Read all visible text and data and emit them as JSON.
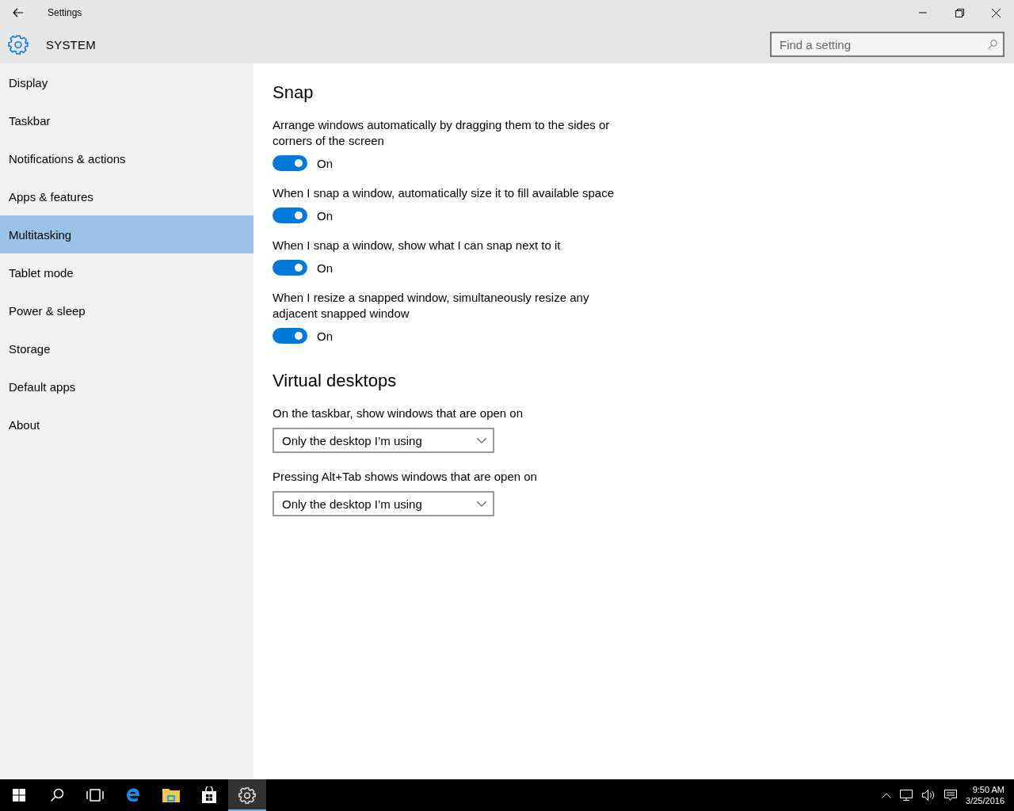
{
  "window": {
    "title": "Settings"
  },
  "header": {
    "title": "SYSTEM",
    "search": {
      "placeholder": "Find a setting"
    }
  },
  "sidebar": {
    "items": [
      {
        "label": "Display",
        "selected": false
      },
      {
        "label": "Taskbar",
        "selected": false
      },
      {
        "label": "Notifications & actions",
        "selected": false
      },
      {
        "label": "Apps & features",
        "selected": false
      },
      {
        "label": "Multitasking",
        "selected": true
      },
      {
        "label": "Tablet mode",
        "selected": false
      },
      {
        "label": "Power & sleep",
        "selected": false
      },
      {
        "label": "Storage",
        "selected": false
      },
      {
        "label": "Default apps",
        "selected": false
      },
      {
        "label": "About",
        "selected": false
      }
    ]
  },
  "sections": [
    {
      "title": "Snap",
      "settings": [
        {
          "kind": "toggle",
          "label": "Arrange windows automatically by dragging them to the sides or corners of the screen",
          "on": true,
          "state_label": "On"
        },
        {
          "kind": "toggle",
          "label": "When I snap a window, automatically size it to fill available space",
          "on": true,
          "state_label": "On"
        },
        {
          "kind": "toggle",
          "label": "When I snap a window, show what I can snap next to it",
          "on": true,
          "state_label": "On"
        },
        {
          "kind": "toggle",
          "label": "When I resize a snapped window, simultaneously resize any adjacent snapped window",
          "on": true,
          "state_label": "On"
        }
      ]
    },
    {
      "title": "Virtual desktops",
      "settings": [
        {
          "kind": "dropdown",
          "label": "On the taskbar, show windows that are open on",
          "value": "Only the desktop I’m using"
        },
        {
          "kind": "dropdown",
          "label": "Pressing Alt+Tab shows windows that are open on",
          "value": "Only the desktop I’m using"
        }
      ]
    }
  ],
  "taskbar": {
    "items": [
      {
        "kind": "start",
        "selected": false
      },
      {
        "kind": "search",
        "selected": false
      },
      {
        "kind": "taskview",
        "selected": false
      },
      {
        "kind": "edge",
        "selected": false
      },
      {
        "kind": "explorer",
        "selected": false
      },
      {
        "kind": "store",
        "selected": false
      },
      {
        "kind": "settings",
        "selected": true
      }
    ],
    "clock": {
      "time": "9:50 AM",
      "date": "3/25/2016"
    }
  }
}
